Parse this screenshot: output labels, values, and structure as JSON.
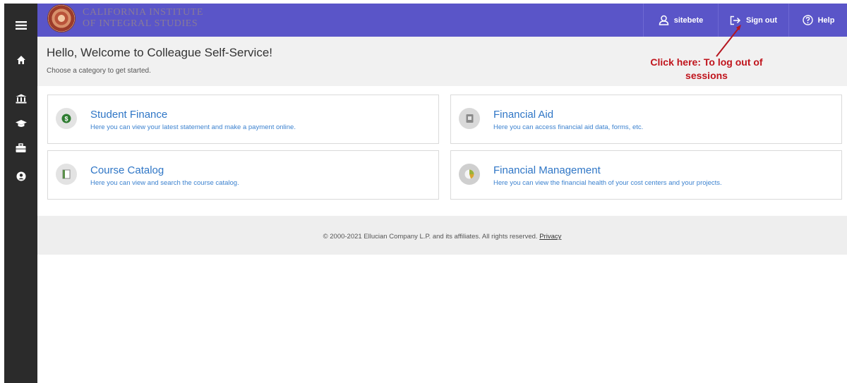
{
  "header": {
    "logo_line1": "CALIFORNIA INSTITUTE",
    "logo_line2": "OF INTEGRAL STUDIES",
    "username": "sitebete",
    "signout_label": "Sign out",
    "help_label": "Help"
  },
  "sidebar": {
    "items": [
      {
        "icon": "menu-icon"
      },
      {
        "icon": "home-icon"
      },
      {
        "icon": "bank-icon"
      },
      {
        "icon": "graduation-cap-icon"
      },
      {
        "icon": "briefcase-icon"
      },
      {
        "icon": "user-circle-icon"
      }
    ]
  },
  "welcome": {
    "title": "Hello, Welcome to Colleague Self-Service!",
    "subtitle": "Choose a category to get started."
  },
  "annotation": {
    "line1": "Click here: To log out of",
    "line2": "sessions"
  },
  "cards": [
    {
      "title": "Student Finance",
      "description": "Here you can view your latest statement and make a payment online.",
      "icon": "student-finance-icon"
    },
    {
      "title": "Financial Aid",
      "description": "Here you can access financial aid data, forms, etc.",
      "icon": "financial-aid-icon"
    },
    {
      "title": "Course Catalog",
      "description": "Here you can view and search the course catalog.",
      "icon": "course-catalog-icon"
    },
    {
      "title": "Financial Management",
      "description": "Here you can view the financial health of your cost centers and your projects.",
      "icon": "financial-management-icon"
    }
  ],
  "footer": {
    "copyright": "© 2000-2021 Ellucian Company L.P. and its affiliates. All rights reserved.",
    "privacy_link": "Privacy"
  },
  "colors": {
    "header_bg": "#5a55c8",
    "sidebar_bg": "#2b2b2b",
    "link_blue": "#2f76c6",
    "annotation_red": "#c0141c"
  }
}
